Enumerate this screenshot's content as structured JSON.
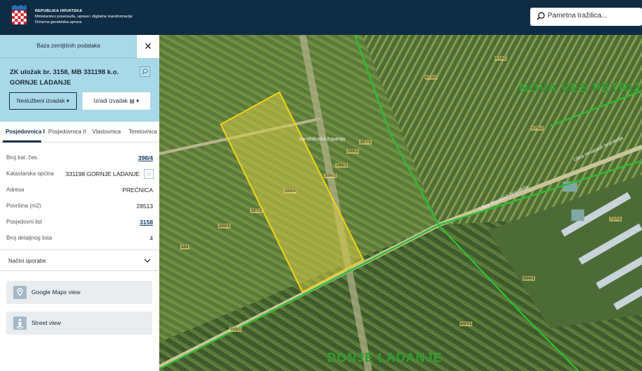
{
  "header": {
    "org_line1": "REPUBLIKA HRVATSKA",
    "org_line2": "Ministarstvo pravosuđa, uprave i digitalne transformacije",
    "org_line3": "Državna geodetska uprava",
    "search_placeholder": "Pametna tražilica..."
  },
  "panel": {
    "title": "Baza zemljišnih podataka",
    "zk_title": "ZK uložak br. 3158, MB 331198 k.o. GORNJE LADANJE",
    "btn_unofficial": "Neslužbeni izvadak",
    "btn_create": "Izradi izvadak",
    "tabs": [
      "Posjedovnica I",
      "Posjedovnica II",
      "Vlastovnica",
      "Teretovnica"
    ],
    "rows": [
      {
        "key": "Broj kat. čes.",
        "value": "398/4"
      },
      {
        "key": "Katastarska općina",
        "value": "331198 GORNJE LADANJE"
      },
      {
        "key": "Adresa",
        "value": "PREĆNICA"
      },
      {
        "key": "Površina (m2)",
        "value": "28513"
      },
      {
        "key": "Posjedovni list",
        "value": "3158"
      },
      {
        "key": "Broj detaljnog lista",
        "value": "4"
      }
    ],
    "accordion_label": "Načini uporabe",
    "google_maps": "Google Maps view",
    "street_view": "Street view"
  },
  "map": {
    "road_label1": "Varaždinska županija",
    "road_label2": "Ulica Hrvatskih branitelja",
    "road_label3": "Ulica Hrvatskih branitelja",
    "place_north": "NOVA VES PETRIJANEČKA",
    "place_south": "DONJE LADANJE",
    "parcels": [
      "398/4",
      "398/3",
      "398/2",
      "397/1",
      "396/2",
      "387/2",
      "386/1",
      "384",
      "389/1",
      "673/2",
      "674/2",
      "676/2",
      "727/1",
      "694/1",
      "690/1"
    ]
  },
  "colors": {
    "header_bg": "#0f2c45",
    "panel_head_bg": "#a9d8e8",
    "selected_parcel": "#f2d21b",
    "boundary_green": "#33b833"
  }
}
